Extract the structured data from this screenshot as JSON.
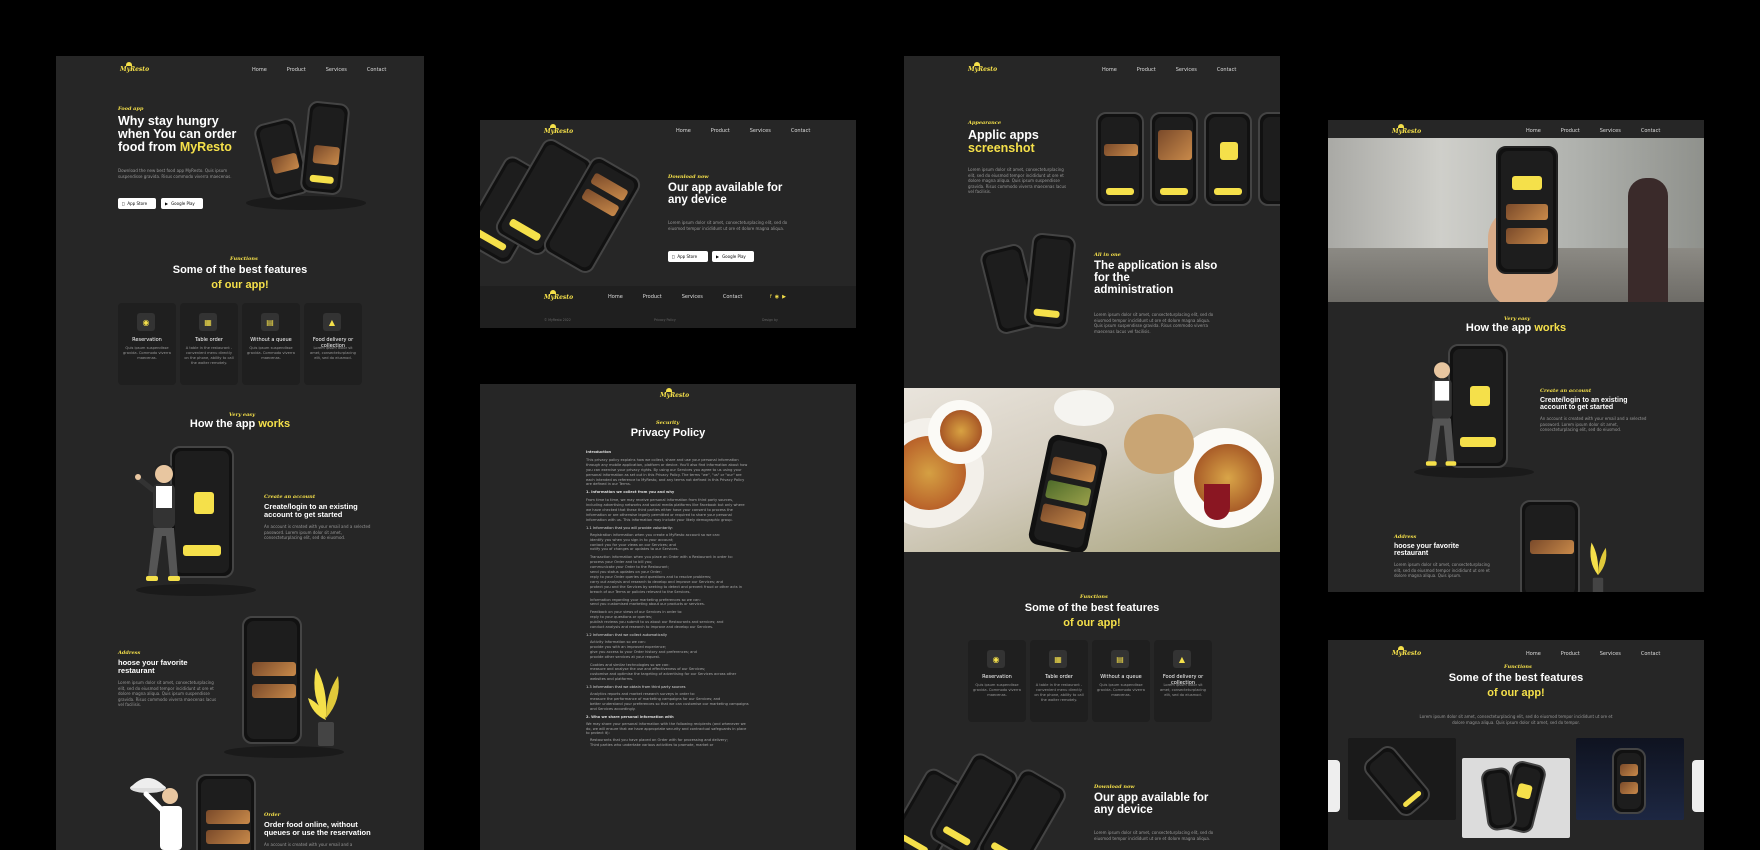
{
  "brand": {
    "logo_text": "MyResto",
    "accent": "#f5e04a",
    "bg": "#262626"
  },
  "nav": [
    "Home",
    "Product",
    "Services",
    "Contact"
  ],
  "panel1": {
    "hero": {
      "tag": "Food app",
      "title_1": "Why stay hungry",
      "title_2": "when You can order",
      "title_3": "food from",
      "title_brand": "MyResto",
      "desc": "Download the new best food app MyResto. Quis ipsum suspendisse gravida. Risus commodo viverra maecenas.",
      "app_store": "App Store",
      "app_store_small": "Download on the",
      "play_store": "Google Play",
      "play_store_small": "GET IT ON"
    },
    "features": {
      "tag": "Functions",
      "title_1": "Some of the best features",
      "title_2": "of our app!",
      "items": [
        {
          "icon": "plate-icon",
          "title": "Reservation",
          "desc": "Quis ipsum suspendisse gravida. Commodo viverra maecenas."
        },
        {
          "icon": "table-icon",
          "title": "Table order",
          "desc": "A table in the restaurant - convenient menu directly on the phone, ability to call the waiter remotely."
        },
        {
          "icon": "queue-icon",
          "title": "Without a queue",
          "desc": "Quis ipsum suspendisse gravida. Commodo viverra maecenas."
        },
        {
          "icon": "bag-icon",
          "title": "Food delivery or collection",
          "desc": "Lorem ipsum dolor sit amet, consecteturplacing elit, sed do eiusmod."
        }
      ]
    },
    "how": {
      "tag": "Very easy",
      "title_1": "How the app",
      "title_2": "works",
      "step1_tag": "Create an account",
      "step1_title": "Create/login to an existing account to get started",
      "step1_desc": "An account is created with your email and a selected password. Lorem ipsum dolor sit amet, consecteturplacing elit, sed do eiusmod.",
      "step2_tag": "Address",
      "step2_title": "hoose your favorite restaurant",
      "step2_desc": "Lorem ipsum dolor sit amet, consecteturplacing elit, sed do eiusmod tempor incididunt ut ore et dolore magna aliqua. Quis ipsum suspendisse gravida. Risus commodo viverra maecenas lacus vel facilisis.",
      "step3_tag": "Order",
      "step3_title": "Order food online, without queues or use the reservation",
      "step3_desc": "An account is created with your email and a"
    }
  },
  "panel2": {
    "tag": "Download now",
    "title_1": "Our app available for",
    "title_2": "any device",
    "desc": "Lorem ipsum dolor sit amet, consecteturplacing elit, sed do eiusmod tempor incididunt ut ore et dolore magna aliqua.",
    "footer_left": "© MyResto 2022",
    "footer_mid": "Privacy Policy",
    "footer_right": "Design by"
  },
  "panel3": {
    "tag": "Security",
    "title": "Privacy Policy",
    "intro_h": "Introduction",
    "intro": "This privacy policy explains how we collect, share and use your personal information through any mobile application, platform or device. You'll also find information about how you can exercise your privacy rights. By using our Services you agree to us using your personal information as set out in this Privacy Policy. The terms \"we\", \"us\" or \"our\" are each intended as reference to MyResto, and any terms not defined in this Privacy Policy are defined in our Terms.",
    "s1": "1. Information we collect from you and why",
    "s1_text": "From time to time, we may receive personal information from third party sources, including advertising networks and social media platforms like Facebook but only where we have checked that these third parties either have your consent to process the information or are otherwise legally permitted or required to share your personal information with us. This information may include your likely demographic group.",
    "s11": "1.1 Information that you will provide voluntarily:",
    "items": [
      "Registration information when you create a MyResto account so we can:",
      "identify you when you sign in to your account;",
      "contact you for your views on our Services; and",
      "notify you of changes or updates to our Services.",
      "Transaction information when you place an Order with a Restaurant in order to:",
      "process your Order and to bill you;",
      "communicate your Order to the Restaurant;",
      "send you status updates on your Order;",
      "reply to your Order queries and questions and to resolve problems;",
      "carry out analysis and research to develop and improve our Services; and",
      "protect you and the Services by seeking to detect and prevent fraud or other acts in breach of our Terms or policies relevant to the Services.",
      "Information regarding your marketing preferences so we can:",
      "send you customised marketing about our products or services.",
      "Feedback on your views of our Services in order to:",
      "reply to your questions or queries;",
      "publish reviews you submit to us about our Restaurants and services; and",
      "conduct analysis and research to improve and develop our Services."
    ],
    "s12": "1.2 Information that we collect automatically",
    "items2": [
      "Activity Information so we can:",
      "provide you with an improved experience;",
      "give you access to your Order history and preferences; and",
      "provide other services at your request.",
      "Cookies and similar technologies so we can:",
      "measure and analyse the use and effectiveness of our Services;",
      "customise and optimise the targeting of advertising for our Services across other websites and platforms."
    ],
    "s13": "1.3 Information that we obtain from third party sources",
    "items3": [
      "Analytics reports and market research surveys in order to:",
      "measure the performance of marketing campaigns for our Services; and",
      "better understand your preferences so that we can customise our marketing campaigns and Services accordingly."
    ],
    "s2": "2. Who we share personal information with",
    "s2_text": "We may share your personal information with the following recipients (and whenever we do, we will ensure that we have appropriate security and contractual safeguards in place to protect it):",
    "items4": [
      "Restaurants that you have placed an Order with for processing and delivery;",
      "Third parties who undertake various activities to promote, market or"
    ]
  },
  "panel4": {
    "screens_tag": "Appearance",
    "screens_title_1": "Applic apps",
    "screens_title_2": "screenshot",
    "screens_desc": "Lorem ipsum dolor sit amet, consecteturplacing elit, sed do eiusmod tempor incididunt ut ore et dolore magna aliqua. Quis ipsum suspendisse gravida. Risus commodo viverra maecenas lacus vel facilisis.",
    "admin_tag": "All in one",
    "admin_title_1": "The application is also",
    "admin_title_2": "for the",
    "admin_title_3": "administration",
    "admin_desc": "Lorem ipsum dolor sit amet, consecteturplacing elit, sed do eiusmod tempor incididunt ut ore et dolore magna aliqua. Quis ipsum suspendisse gravida. Risus commodo viverra maecenas lacus vel facilisis.",
    "features_tag": "Functions",
    "features_title_1": "Some of the best features",
    "features_title_2": "of our app!",
    "download_tag": "Download now",
    "download_title_1": "Our app available for",
    "download_title_2": "any device",
    "download_desc": "Lorem ipsum dolor sit amet, consecteturplacing elit, sed do eiusmod tempor incididunt ut ore et dolore magna aliqua."
  },
  "panel5": {
    "how_tag": "Very easy",
    "how_title_1": "How the app",
    "how_title_2": "works",
    "step1_tag": "Create an account",
    "step1_title": "Create/login to an existing account to get started",
    "step1_desc": "An account is created with your email and a selected password. Lorem ipsum dolor sit amet, consecteturplacing elit, sed do eiusmod.",
    "step2_tag": "Address",
    "step2_title": "hoose your favorite restaurant",
    "step2_desc": "Lorem ipsum dolor sit amet, consecteturplacing elit, sed do eiusmod tempor incididunt ut ore et dolore magna aliqua. Quis ipsum."
  },
  "panel6": {
    "tag": "Functions",
    "title_1": "Some of the best features",
    "title_2": "of our app!",
    "desc": "Lorem ipsum dolor sit amet, consecteturplacing elit, sed do eiusmod tempor incididunt ut ore et dolore magna aliqua. Quis ipsum dolor sit amet, sed do tempor."
  }
}
